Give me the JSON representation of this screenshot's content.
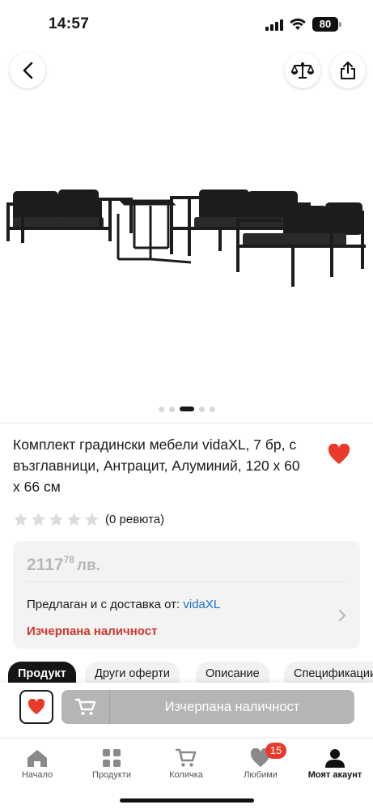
{
  "status_bar": {
    "time": "14:57",
    "battery": "80"
  },
  "product": {
    "title": "Комплект градински мебели vidaXL, 7 бр, с възглавници, Антрацит, Алуминий, 120 x 60 x 66 см",
    "image_alt": "Garden furniture set",
    "gallery": {
      "total": 5,
      "active_index": 2
    },
    "rating": {
      "stars": 0,
      "max": 5,
      "reviews_text": "(0 ревюта)"
    }
  },
  "pricing": {
    "price_main": "2117",
    "price_cents": "78",
    "currency": "лв.",
    "seller_prefix": "Предлаган и с доставка от:",
    "seller_name": "vidaXL",
    "stock_status": "Изчерпана наличност"
  },
  "tabs": [
    {
      "label": "Продукт",
      "active": true
    },
    {
      "label": "Други оферти",
      "active": false
    },
    {
      "label": "Описание",
      "active": false
    },
    {
      "label": "Спецификации",
      "active": false
    }
  ],
  "buy_bar": {
    "cart_label": "Изчерпана наличност"
  },
  "bottom_nav": [
    {
      "label": "Начало",
      "icon": "home-icon"
    },
    {
      "label": "Продукти",
      "icon": "grid-icon"
    },
    {
      "label": "Количка",
      "icon": "cart-icon"
    },
    {
      "label": "Любими",
      "icon": "heart-icon",
      "badge": "15"
    },
    {
      "label": "Моят акаунт",
      "icon": "user-icon",
      "active": true
    }
  ],
  "colors": {
    "accent_red": "#e8392a",
    "link_blue": "#1a73c9",
    "stock_red": "#d0382c",
    "disabled_gray": "#b5b5b5"
  }
}
